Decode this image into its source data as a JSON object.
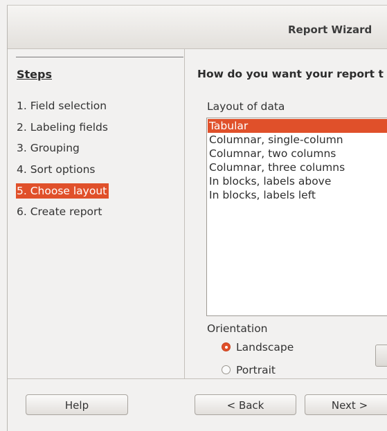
{
  "window": {
    "title": "Report Wizard"
  },
  "sidebar": {
    "heading": "Steps",
    "steps": [
      {
        "label": "1. Field selection",
        "active": false
      },
      {
        "label": "2. Labeling fields",
        "active": false
      },
      {
        "label": "3. Grouping",
        "active": false
      },
      {
        "label": "4. Sort options",
        "active": false
      },
      {
        "label": "5. Choose layout",
        "active": true
      },
      {
        "label": "6. Create report",
        "active": false
      }
    ]
  },
  "main": {
    "question": "How do you want your report t",
    "layout_label": "Layout of data",
    "layouts": [
      {
        "label": "Tabular",
        "selected": true
      },
      {
        "label": "Columnar, single-column",
        "selected": false
      },
      {
        "label": "Columnar, two columns",
        "selected": false
      },
      {
        "label": "Columnar, three columns",
        "selected": false
      },
      {
        "label": "In blocks, labels above",
        "selected": false
      },
      {
        "label": "In blocks, labels left",
        "selected": false
      }
    ],
    "orientation_label": "Orientation",
    "orientation_options": [
      {
        "label": "Landscape",
        "checked": true
      },
      {
        "label": "Portrait",
        "checked": false
      }
    ]
  },
  "buttons": {
    "help": "Help",
    "back": "< Back",
    "next": "Next >"
  },
  "colors": {
    "accent": "#e0502a",
    "background": "#f2f1f0"
  }
}
